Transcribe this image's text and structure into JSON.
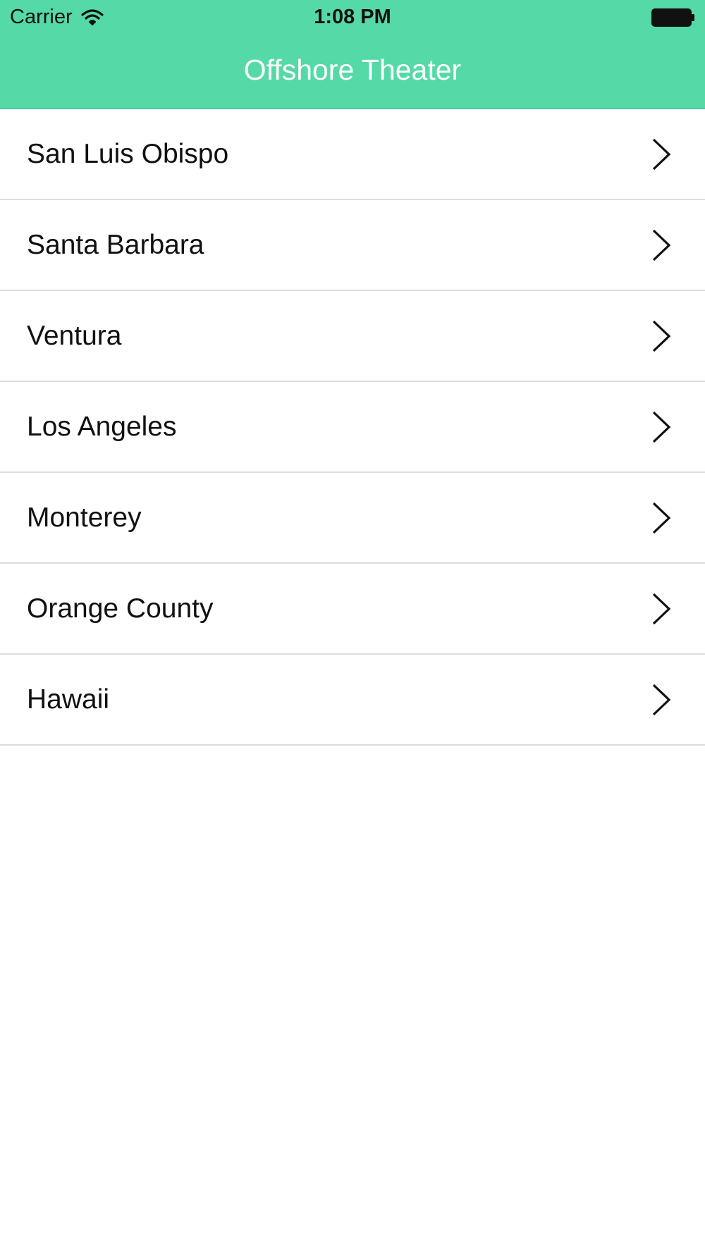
{
  "status_bar": {
    "carrier": "Carrier",
    "time": "1:08 PM",
    "wifi_icon": "wifi-icon",
    "battery_icon": "battery-icon"
  },
  "nav": {
    "title": "Offshore Theater",
    "background_color": "#55d9a6"
  },
  "list": {
    "items": [
      {
        "label": "San Luis Obispo",
        "icon": "chevron-right-icon"
      },
      {
        "label": "Santa Barbara",
        "icon": "chevron-right-icon"
      },
      {
        "label": "Ventura",
        "icon": "chevron-right-icon"
      },
      {
        "label": "Los Angeles",
        "icon": "chevron-right-icon"
      },
      {
        "label": "Monterey",
        "icon": "chevron-right-icon"
      },
      {
        "label": "Orange County",
        "icon": "chevron-right-icon"
      },
      {
        "label": "Hawaii",
        "icon": "chevron-right-icon"
      }
    ]
  }
}
